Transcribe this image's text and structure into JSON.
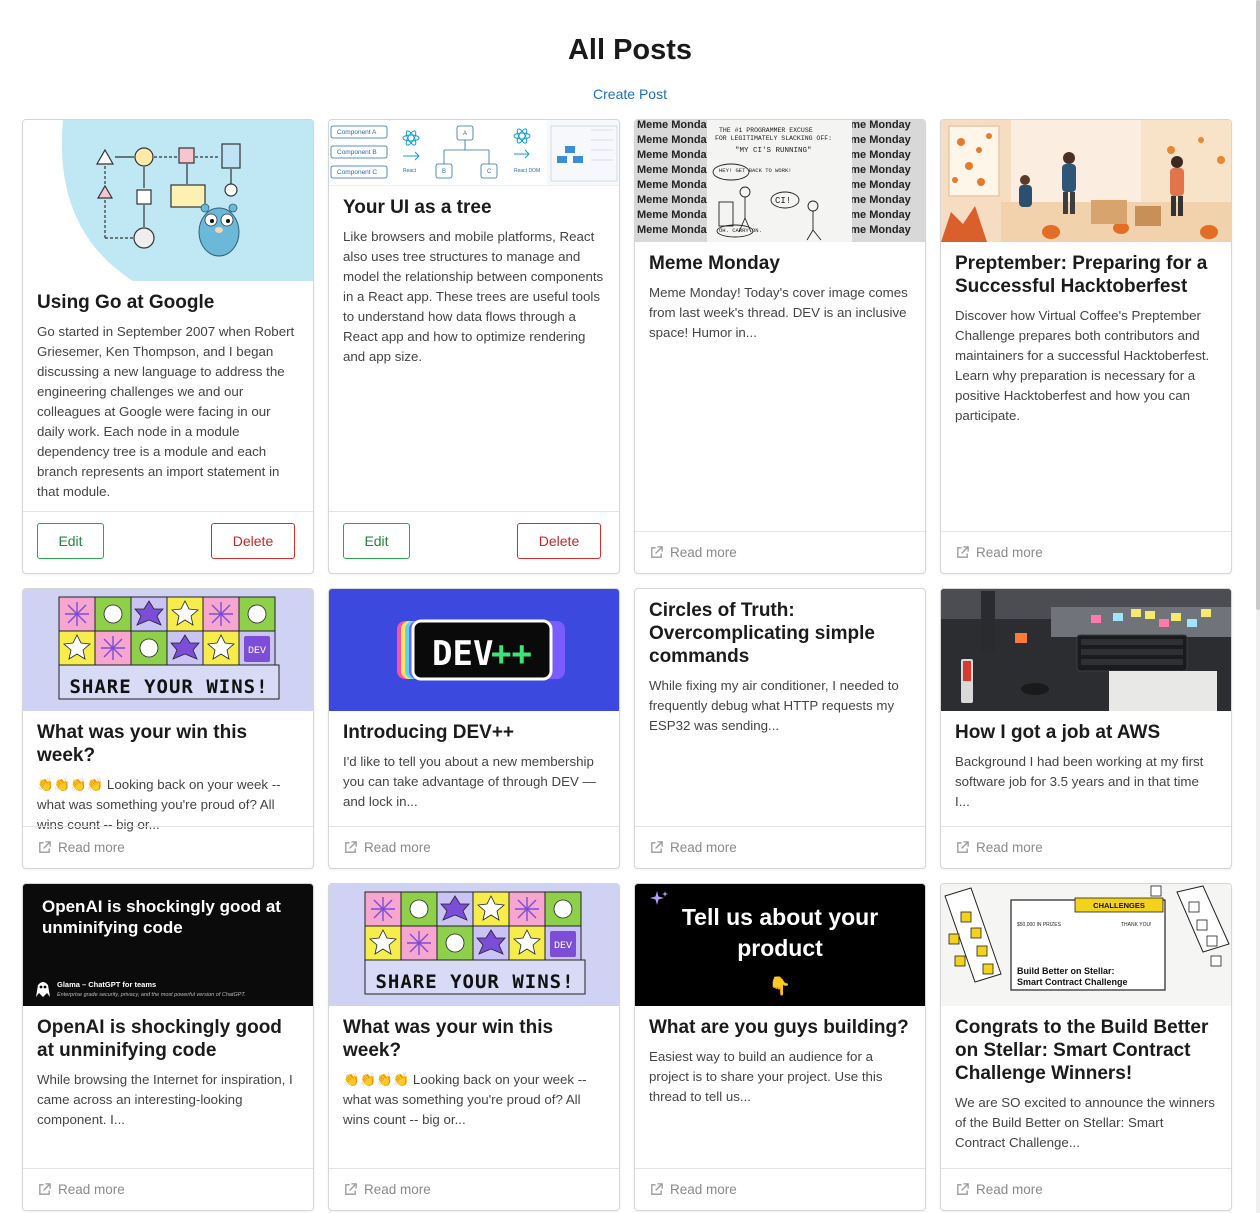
{
  "page": {
    "title": "All Posts",
    "create_link": "Create Post"
  },
  "actions": {
    "edit_label": "Edit",
    "delete_label": "Delete",
    "read_more_label": "Read more"
  },
  "posts": [
    {
      "title": "Using Go at Google",
      "description": "Go started in September 2007 when Robert Griesemer, Ken Thompson, and I began discussing a new language to address the engineering challenges we and our colleagues at Google were facing in our daily work. Each node in a module dependency tree is a module and each branch represents an import statement in that module.",
      "image": "go-gopher-diagram"
    },
    {
      "title": "Your UI as a tree",
      "description": "Like browsers and mobile platforms, React also uses tree structures to manage and model the relationship between components in a React app. These trees are useful tools to understand how data flows through a React app and how to optimize rendering and app size.",
      "image": "react-component-tree",
      "image_labels": [
        "Component A",
        "Component B",
        "Component C",
        "A",
        "B",
        "C",
        "React",
        "React DOM"
      ]
    },
    {
      "title": "Meme Monday",
      "description": "Meme Monday! Today's cover image comes from last week's thread. DEV is an inclusive space! Humor in...",
      "image": "meme-monday-comic",
      "image_labels": [
        "Meme Monday",
        "THE #1 PROGRAMMER EXCUSE FOR LEGITIMATELY SLACKING OFF:",
        "\"MY CI'S RUNNING\"",
        "HEY! GET BACK TO WORK!",
        "CI!",
        "OH. CARRY ON."
      ]
    },
    {
      "title": "Preptember: Preparing for a Successful Hacktoberfest",
      "description": "Discover how Virtual Coffee's Preptember Challenge prepares both contributors and maintainers for a successful Hacktoberfest. Learn why preparation is necessary for a positive Hacktoberfest and how you can participate.",
      "image": "autumn-illustration"
    },
    {
      "title": "What was your win this week?",
      "description": "👏👏👏👏 Looking back on your week -- what was something you're proud of? All wins count -- big or...",
      "image": "share-your-wins",
      "image_labels": [
        "SHARE YOUR WINS!",
        "DEV"
      ]
    },
    {
      "title": "Introducing DEV++",
      "description": "I'd like to tell you about a new membership you can take advantage of through DEV — and lock in...",
      "image": "dev-plus-plus",
      "image_labels": [
        "DEV",
        "++"
      ]
    },
    {
      "title": "Circles of Truth: Overcomplicating simple commands",
      "description": "While fixing my air conditioner, I needed to frequently debug what HTTP requests my ESP32 was sending...",
      "image": ""
    },
    {
      "title": "How I got a job at AWS",
      "description": "Background I had been working at my first software job for 3.5 years and in that time I...",
      "image": "desk-photo"
    },
    {
      "title": "OpenAI is shockingly good at unminifying code",
      "description": "While browsing the Internet for inspiration, I came across an interesting-looking component. I...",
      "image": "openai-banner",
      "image_labels": [
        "OpenAI is shockingly good at unminifying code",
        "Glama – ChatGPT for teams",
        "Enterprise grade security, privacy, and the most powerful version of ChatGPT."
      ]
    },
    {
      "title": "What was your win this week?",
      "description": "👏👏👏👏 Looking back on your week -- what was something you're proud of? All wins count -- big or...",
      "image": "share-your-wins",
      "image_labels": [
        "SHARE YOUR WINS!",
        "DEV"
      ]
    },
    {
      "title": "What are you guys building?",
      "description": "Easiest way to build an audience for a project is to share your project. Use this thread to tell us...",
      "image": "tell-us-product",
      "image_labels": [
        "Tell us about your product",
        "👇"
      ]
    },
    {
      "title": "Congrats to the Build Better on Stellar: Smart Contract Challenge Winners!",
      "description": "We are SO excited to announce the winners of the Build Better on Stellar: Smart Contract Challenge...",
      "image": "stellar-challenge",
      "image_labels": [
        "CHALLENGES",
        "$50,000 IN PRIZES",
        "THANK YOU!",
        "Build Better on Stellar: Smart Contract Challenge"
      ]
    }
  ],
  "icons": {
    "external_link": "external-link-icon"
  },
  "colors": {
    "link": "#1d6fb8",
    "edit": "#2ea44f",
    "delete": "#d32f2f",
    "dev_blue": "#3b49df"
  }
}
